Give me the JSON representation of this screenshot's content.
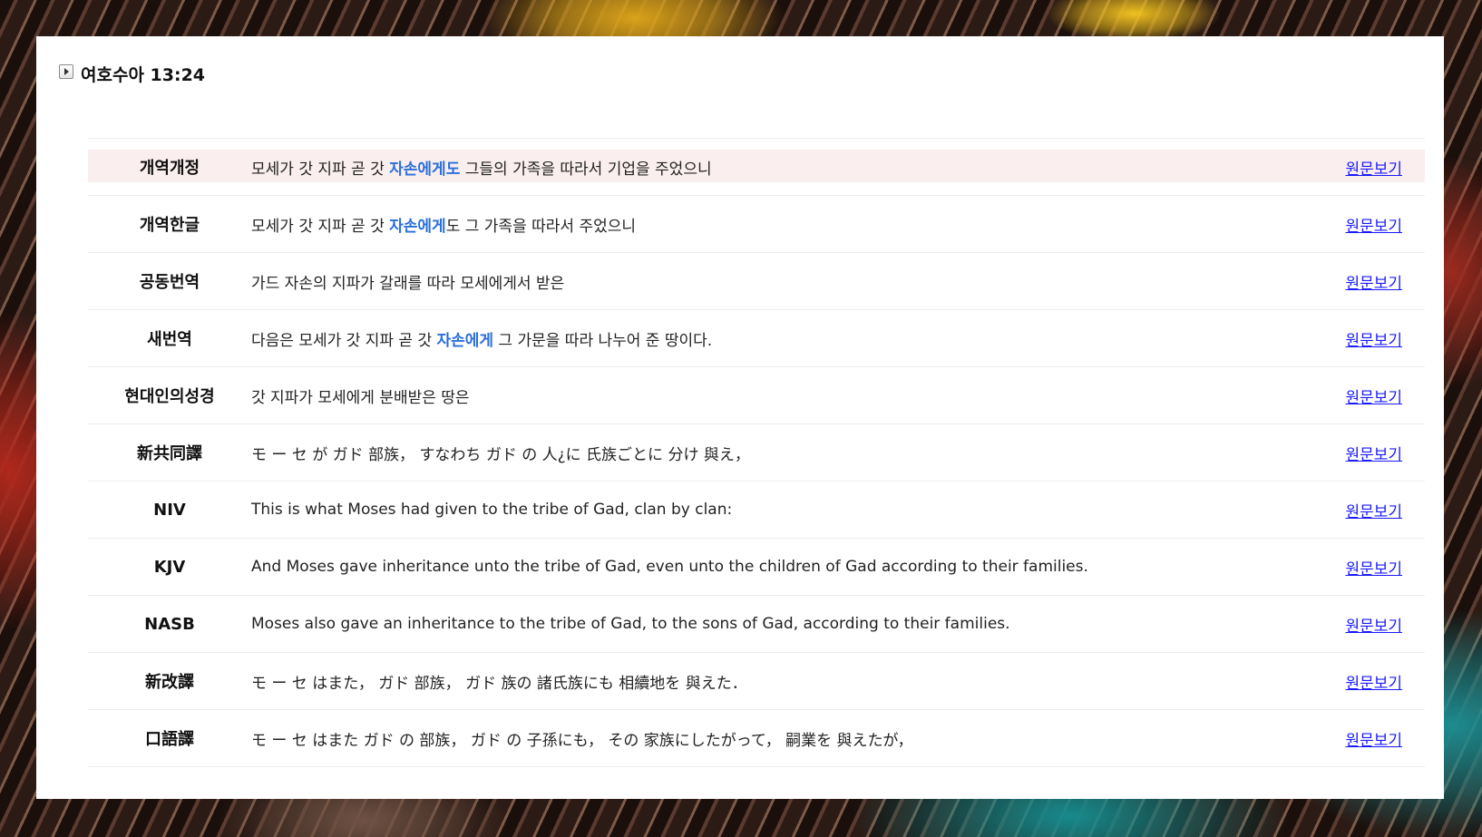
{
  "header": {
    "title": "여호수아 13:24"
  },
  "link_label": "원문보기",
  "colors": {
    "highlight_text": "#2a6fdb",
    "highlight_row": "#fbeeee",
    "link": "#1a1aff"
  },
  "versions": [
    {
      "name": "개역개정",
      "pre": "모세가 갓 지파 곧 갓 ",
      "hl": "자손에게도",
      "post": " 그들의 가족을 따라서 기업을 주었으니",
      "link": "원문보기"
    },
    {
      "name": "개역한글",
      "pre": "모세가 갓 지파 곧 갓 ",
      "hl": "자손에게",
      "post": "도 그 가족을 따라서 주었으니",
      "link": "원문보기"
    },
    {
      "name": "공동번역",
      "pre": "가드 자손의 지파가 갈래를 따라 모세에게서 받은",
      "hl": "",
      "post": "",
      "link": "원문보기"
    },
    {
      "name": "새번역",
      "pre": "다음은 모세가 갓 지파 곧 갓 ",
      "hl": "자손에게",
      "post": " 그 가문을 따라 나누어 준 땅이다.",
      "link": "원문보기"
    },
    {
      "name": "현대인의성경",
      "pre": "갓 지파가 모세에게 분배받은 땅은",
      "hl": "",
      "post": "",
      "link": "원문보기"
    },
    {
      "name": "新共同譯",
      "pre": "モ ー セ が ガド 部族， すなわち ガド の 人¿に 氏族ごとに 分け 與え，",
      "hl": "",
      "post": "",
      "link": "원문보기"
    },
    {
      "name": "NIV",
      "pre": "This is what Moses had given to the tribe of Gad, clan by clan:",
      "hl": "",
      "post": "",
      "link": "원문보기"
    },
    {
      "name": "KJV",
      "pre": "And Moses gave inheritance unto the tribe of Gad, even unto the children of Gad according to their families.",
      "hl": "",
      "post": "",
      "link": "원문보기"
    },
    {
      "name": "NASB",
      "pre": "Moses also gave an inheritance to the tribe of Gad, to the sons of Gad, according to their families.",
      "hl": "",
      "post": "",
      "link": "원문보기"
    },
    {
      "name": "新改譯",
      "pre": "モ ー セ はまた， ガド 部族， ガド 族の 諸氏族にも 相續地を 與えた．",
      "hl": "",
      "post": "",
      "link": "원문보기"
    },
    {
      "name": "口語譯",
      "pre": "モ ー セ はまた ガド の 部族， ガド の 子孫にも， その 家族にしたがって， 嗣業を 與えたが，",
      "hl": "",
      "post": "",
      "link": "원문보기"
    }
  ]
}
